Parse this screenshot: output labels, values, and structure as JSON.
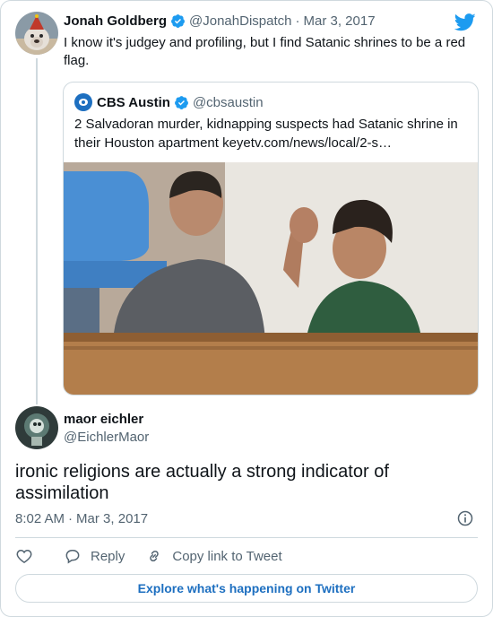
{
  "parent": {
    "name": "Jonah Goldberg",
    "handle": "@JonahDispatch",
    "separator": "·",
    "date": "Mar 3, 2017",
    "text": "I know it's judgey and profiling, but I find Satanic shrines to be a red flag."
  },
  "quote": {
    "name": "CBS Austin",
    "handle": "@cbsaustin",
    "text": "2 Salvadoran murder, kidnapping suspects had Satanic shrine in their Houston apartment keyetv.com/news/local/2-s…"
  },
  "tweet": {
    "name": "maor eichler",
    "handle": "@EichlerMaor",
    "text": "ironic religions are actually a strong indicator of assimilation",
    "time": "8:02 AM",
    "separator": "·",
    "date": "Mar 3, 2017"
  },
  "actions": {
    "reply_label": "Reply",
    "copy_label": "Copy link to Tweet"
  },
  "explore_label": "Explore what's happening on Twitter",
  "colors": {
    "brand": "#1d9bf0",
    "link": "#1d6fc0",
    "muted": "#536471",
    "border": "#cfd9de"
  },
  "icons": [
    "twitter-bird-icon",
    "verified-badge-icon",
    "info-icon",
    "heart-icon",
    "reply-icon",
    "link-icon"
  ]
}
